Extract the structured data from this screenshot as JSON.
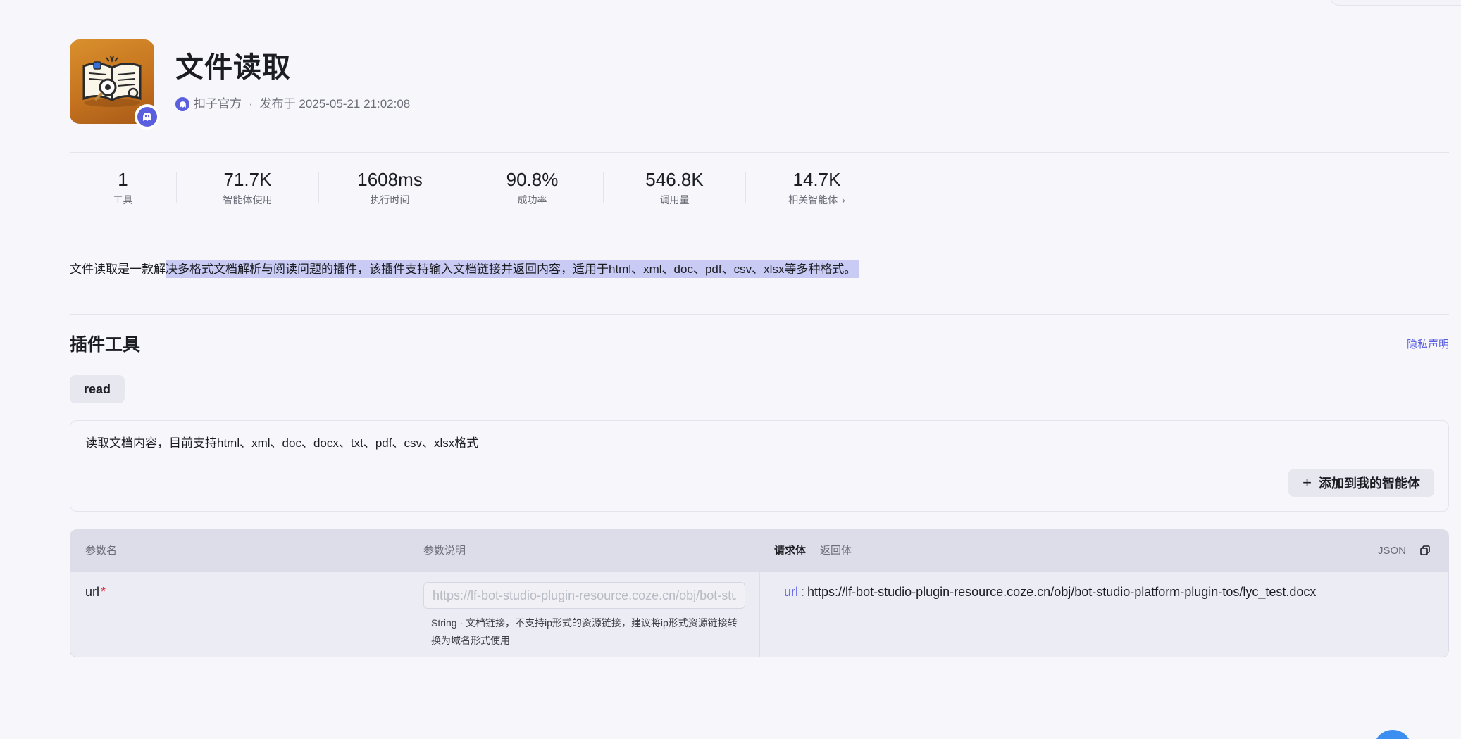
{
  "plugin": {
    "title": "文件读取",
    "publisher": "扣子官方",
    "separator": "·",
    "published_at": "发布于 2025-05-21 21:02:08",
    "icon": "book-reading-icon",
    "badge_icon": "coze-official-badge-icon"
  },
  "stats": [
    {
      "value": "1",
      "label": "工具"
    },
    {
      "value": "71.7K",
      "label": "智能体使用"
    },
    {
      "value": "1608ms",
      "label": "执行时间"
    },
    {
      "value": "90.8%",
      "label": "成功率"
    },
    {
      "value": "546.8K",
      "label": "调用量"
    },
    {
      "value": "14.7K",
      "label": "相关智能体",
      "chevron": "›"
    }
  ],
  "description": {
    "plain": "文件读取是一款解",
    "highlighted": "决多格式文档解析与阅读问题的插件，该插件支持输入文档链接并返回内容，适用于html、xml、doc、pdf、csv、xlsx等多种格式。"
  },
  "tools_section": {
    "title": "插件工具",
    "privacy_link": "隐私声明",
    "tabs": [
      {
        "label": "read",
        "selected": true
      }
    ],
    "tool_description": "读取文档内容，目前支持html、xml、doc、docx、txt、pdf、csv、xlsx格式",
    "add_button": {
      "icon": "+",
      "label": "添加到我的智能体"
    }
  },
  "params_table": {
    "headers": {
      "name": "参数名",
      "desc": "参数说明"
    },
    "body_tabs": [
      {
        "label": "请求体",
        "active": true
      },
      {
        "label": "返回体",
        "active": false
      }
    ],
    "json_label": "JSON",
    "copy_icon": "copy-icon",
    "rows": [
      {
        "name": "url",
        "required_mark": "*",
        "input_placeholder": "https://lf-bot-studio-plugin-resource.coze.cn/obj/bot-studio-platform-plugin-tos/lyc_test.docx",
        "help": "String · 文档链接，不支持ip形式的资源链接，建议将ip形式资源链接转换为域名形式使用"
      }
    ],
    "json_example": {
      "key": "url",
      "colon": ":",
      "value": "https://lf-bot-studio-plugin-resource.coze.cn/obj/bot-studio-platform-plugin-tos/lyc_test.docx"
    }
  },
  "colors": {
    "accent": "#5a5fe0",
    "highlight": "#c9cbf4",
    "required": "#e0384e",
    "icon_bg": "#c5731f",
    "fab": "#3c8ff0"
  }
}
